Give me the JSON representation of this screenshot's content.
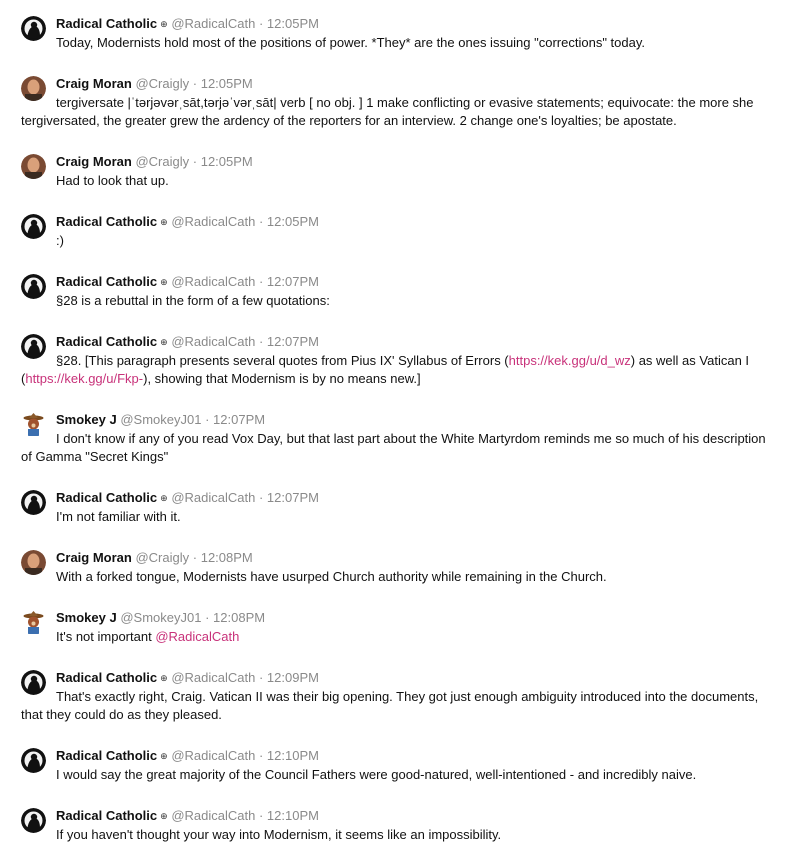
{
  "posts": [
    {
      "name": "Radical Catholic",
      "badge": "⊕",
      "handle": "@RadicalCath",
      "sep": "·",
      "time": "12:05PM",
      "avatar": "rc",
      "segments": [
        {
          "t": "Today, Modernists hold most of the positions of power. *They* are the ones issuing \"corrections\" today."
        }
      ]
    },
    {
      "name": "Craig Moran",
      "badge": "",
      "handle": "@Craigly",
      "sep": "·",
      "time": "12:05PM",
      "avatar": "cm",
      "segments": [
        {
          "t": "tergiversate |ˈtərjəvərˌsāt,tərjəˈvərˌsāt| verb [ no obj. ] 1 make conflicting or evasive statements; equivocate: the more she tergiversated, the greater grew the ardency of the reporters for an interview. 2 change one's loyalties; be apostate."
        }
      ]
    },
    {
      "name": "Craig Moran",
      "badge": "",
      "handle": "@Craigly",
      "sep": "·",
      "time": "12:05PM",
      "avatar": "cm",
      "segments": [
        {
          "t": "Had to look that up."
        }
      ]
    },
    {
      "name": "Radical Catholic",
      "badge": "⊕",
      "handle": "@RadicalCath",
      "sep": "·",
      "time": "12:05PM",
      "avatar": "rc",
      "segments": [
        {
          "t": ":)"
        }
      ]
    },
    {
      "name": "Radical Catholic",
      "badge": "⊕",
      "handle": "@RadicalCath",
      "sep": "·",
      "time": "12:07PM",
      "avatar": "rc",
      "segments": [
        {
          "t": "§28 is a rebuttal in the form of a few quotations:"
        }
      ]
    },
    {
      "name": "Radical Catholic",
      "badge": "⊕",
      "handle": "@RadicalCath",
      "sep": "·",
      "time": "12:07PM",
      "avatar": "rc",
      "segments": [
        {
          "t": "§28. [This paragraph presents several quotes from Pius IX' Syllabus of Errors ("
        },
        {
          "t": "https://kek.gg/u/d_wz",
          "link": true
        },
        {
          "t": ") as well as Vatican I ("
        },
        {
          "t": "https://kek.gg/u/Fkp-",
          "link": true
        },
        {
          "t": "), showing that Modernism is by no means new.]"
        }
      ]
    },
    {
      "name": "Smokey J",
      "badge": "",
      "handle": "@SmokeyJ01",
      "sep": "·",
      "time": "12:07PM",
      "avatar": "sj",
      "segments": [
        {
          "t": "I don't know if any of you read Vox Day, but that last part about the White Martyrdom reminds me so much of his description of Gamma \"Secret Kings\""
        }
      ]
    },
    {
      "name": "Radical Catholic",
      "badge": "⊕",
      "handle": "@RadicalCath",
      "sep": "·",
      "time": "12:07PM",
      "avatar": "rc",
      "segments": [
        {
          "t": "I'm not familiar with it."
        }
      ]
    },
    {
      "name": "Craig Moran",
      "badge": "",
      "handle": "@Craigly",
      "sep": "·",
      "time": "12:08PM",
      "avatar": "cm",
      "segments": [
        {
          "t": "With a forked tongue, Modernists have usurped Church authority while remaining in the Church."
        }
      ]
    },
    {
      "name": "Smokey J",
      "badge": "",
      "handle": "@SmokeyJ01",
      "sep": "·",
      "time": "12:08PM",
      "avatar": "sj",
      "segments": [
        {
          "t": "It's not important "
        },
        {
          "t": "@RadicalCath",
          "link": true
        }
      ]
    },
    {
      "name": "Radical Catholic",
      "badge": "⊕",
      "handle": "@RadicalCath",
      "sep": "·",
      "time": "12:09PM",
      "avatar": "rc",
      "segments": [
        {
          "t": "That's exactly right, Craig. Vatican II was their big opening. They got just enough ambiguity introduced into the documents, that they could do as they pleased."
        }
      ]
    },
    {
      "name": "Radical Catholic",
      "badge": "⊕",
      "handle": "@RadicalCath",
      "sep": "·",
      "time": "12:10PM",
      "avatar": "rc",
      "segments": [
        {
          "t": "I would say the great majority of the Council Fathers were good-natured, well-intentioned - and incredibly naive."
        }
      ]
    },
    {
      "name": "Radical Catholic",
      "badge": "⊕",
      "handle": "@RadicalCath",
      "sep": "·",
      "time": "12:10PM",
      "avatar": "rc",
      "segments": [
        {
          "t": "If you haven't thought your way into Modernism, it seems like an impossibility."
        }
      ]
    }
  ],
  "avatars": {
    "rc": {
      "icon": "radical-catholic-avatar-icon",
      "bg": "#111111",
      "fg": "#f2f2f2"
    },
    "cm": {
      "icon": "craig-moran-avatar-icon",
      "bg": "#7a4a33",
      "fg": "#d9a07a"
    },
    "sj": {
      "icon": "smokey-bear-avatar-icon",
      "bg": "#ffffff",
      "fg": "#a0522d"
    }
  },
  "colors": {
    "link": "#c8327a",
    "meta": "#8a8a8a",
    "text": "#111111"
  }
}
